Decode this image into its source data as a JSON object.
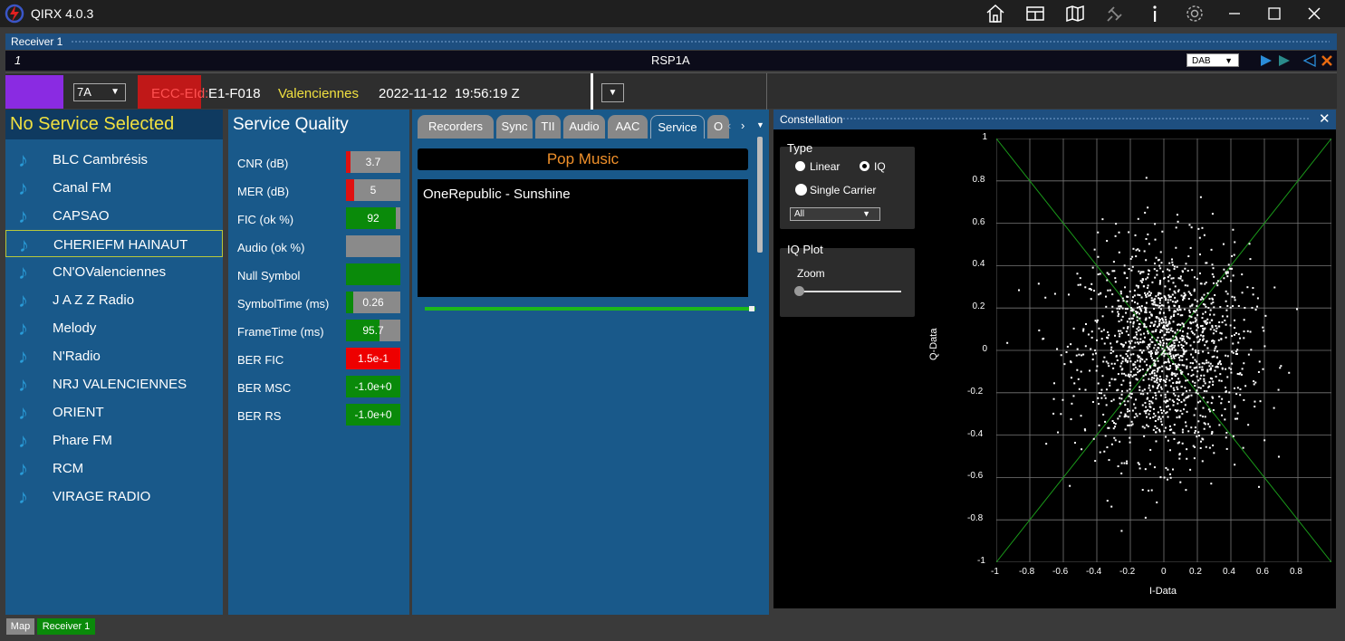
{
  "app": {
    "title": "QIRX 4.0.3",
    "icons": [
      "home-icon",
      "window-icon",
      "map-icon",
      "satellite-icon",
      "info-icon",
      "gear-icon"
    ],
    "window_controls": [
      "minimize-icon",
      "maximize-icon",
      "close-icon"
    ]
  },
  "receiver": {
    "tab_label": "Receiver 1",
    "index": "1",
    "device": "RSP1A",
    "mode": "DAB"
  },
  "controls": {
    "channel": "7A",
    "ecc_label": "ECC-EId:",
    "ecc_value": "E1-F018",
    "ensemble": "Valenciennes",
    "datetime": "2022-11-12  19:56:19 Z"
  },
  "service_panel": {
    "header": "No Service Selected",
    "selected_index": 3,
    "services": [
      "BLC Cambrésis",
      "Canal FM",
      "CAPSAO",
      "CHERIEFM HAINAUT",
      "CN'OValenciennes",
      "J A Z Z Radio",
      "Melody",
      "N'Radio",
      "NRJ VALENCIENNES",
      "ORIENT",
      "Phare FM",
      "RCM",
      "VIRAGE RADIO"
    ]
  },
  "quality": {
    "header": "Service Quality",
    "rows": [
      {
        "label": "CNR (dB)",
        "value": "3.7",
        "fill_frac": 0.08,
        "fill_color": "#e01010"
      },
      {
        "label": "MER (dB)",
        "value": "5",
        "fill_frac": 0.15,
        "fill_color": "#e01010"
      },
      {
        "label": "FIC (ok %)",
        "value": "92",
        "fill_frac": 0.92,
        "fill_color": "#0a8a0a"
      },
      {
        "label": "Audio (ok %)",
        "value": "",
        "fill_frac": 0,
        "fill_color": "#0a8a0a"
      },
      {
        "label": "Null Symbol",
        "value": "",
        "fill_frac": 1,
        "fill_color": "#0a8a0a"
      },
      {
        "label": "SymbolTime (ms)",
        "value": "0.26",
        "fill_frac": 0.13,
        "fill_color": "#0a8a0a"
      },
      {
        "label": "FrameTime (ms)",
        "value": "95.7",
        "fill_frac": 0.62,
        "fill_color": "#0a8a0a"
      },
      {
        "label": "BER FIC",
        "value": "1.5e-1",
        "fill_frac": 1,
        "fill_color": "#ee0000"
      },
      {
        "label": "BER MSC",
        "value": "-1.0e+0",
        "fill_frac": 1,
        "fill_color": "#0a8a0a"
      },
      {
        "label": "BER RS",
        "value": "-1.0e+0",
        "fill_frac": 1,
        "fill_color": "#0a8a0a"
      }
    ]
  },
  "tabs": {
    "items": [
      "Recorders",
      "Sync",
      "TII",
      "Audio",
      "AAC",
      "Service",
      "O"
    ],
    "active": "Service",
    "genre": "Pop Music",
    "dls_text": "OneRepublic - Sunshine"
  },
  "constellation": {
    "title": "Constellation",
    "type_label": "Type",
    "linear_label": "Linear",
    "iq_label": "IQ",
    "single_carrier_label": "Single Carrier",
    "carrier_select": "All",
    "iq_plot_label": "IQ Plot",
    "zoom_label": "Zoom",
    "zoom_level": 0
  },
  "chart_data": {
    "type": "scatter",
    "xlabel": "I-Data",
    "ylabel": "Q-Data",
    "xlim": [
      -1,
      1
    ],
    "ylim": [
      -1,
      1
    ],
    "xticks": [
      "-1",
      "-0.8",
      "-0.6",
      "-0.4",
      "-0.2",
      "0",
      "0.2",
      "0.4",
      "0.6",
      "0.8"
    ],
    "yticks": [
      "1",
      "0.8",
      "0.6",
      "0.4",
      "0.2",
      "0",
      "-0.2",
      "-0.4",
      "-0.6",
      "-0.8",
      "-1"
    ],
    "grid": true,
    "reference_lines": [
      [
        [
          -1,
          -1
        ],
        [
          1,
          1
        ]
      ],
      [
        [
          -1,
          1
        ],
        [
          1,
          -1
        ]
      ]
    ],
    "distribution": "gaussian cloud centered at (0,0), std approx 0.25, ~1500 points"
  },
  "bottom": {
    "tabs": [
      "Map",
      "Receiver 1"
    ],
    "active": "Receiver 1"
  }
}
